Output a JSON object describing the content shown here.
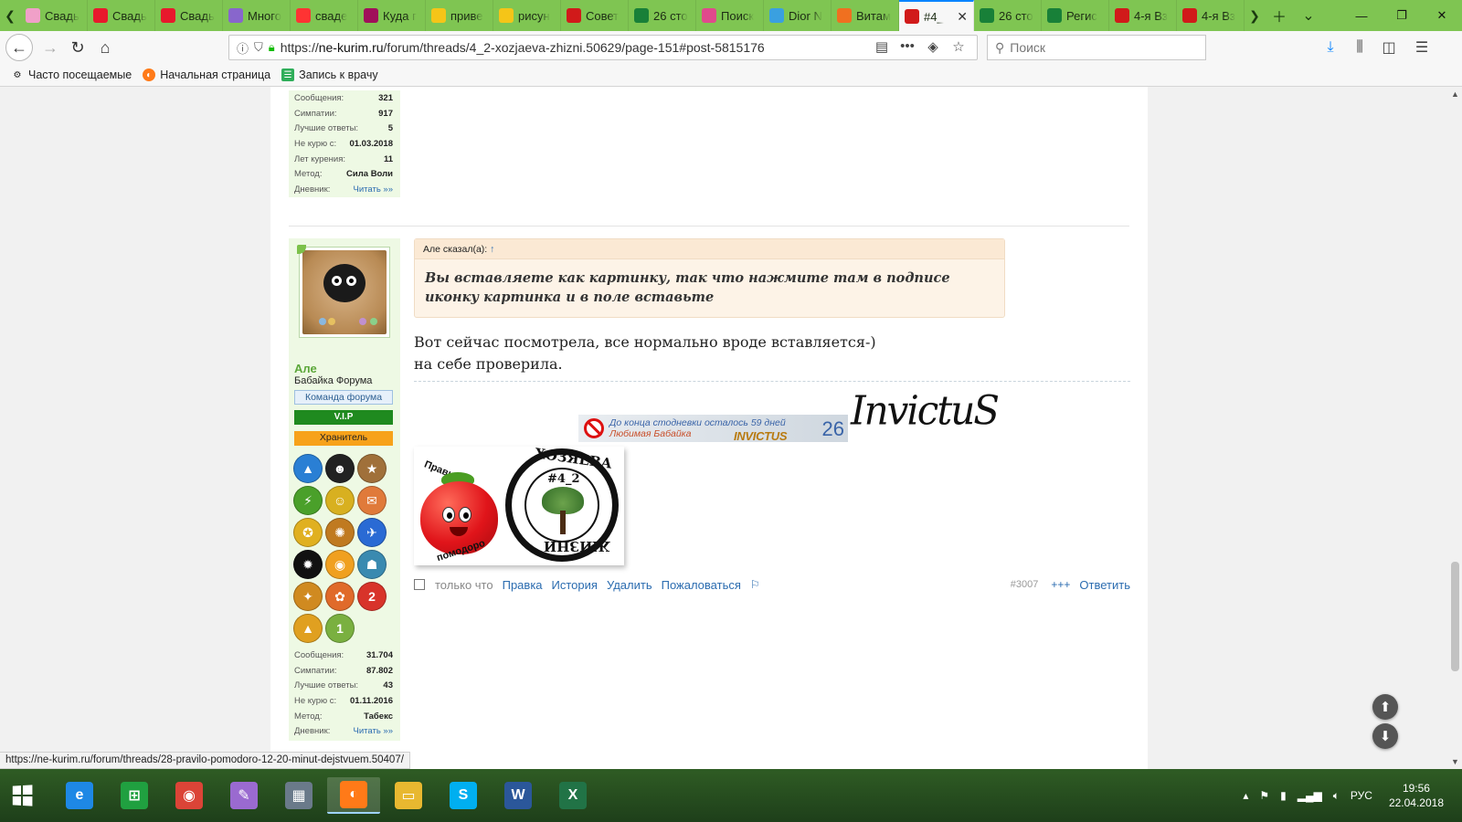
{
  "tabs": [
    {
      "label": "Свадь",
      "icon": "pink-ribbon-icon",
      "color": "#f0a0c8"
    },
    {
      "label": "Свадь",
      "icon": "heart-icon",
      "color": "#e8192c"
    },
    {
      "label": "Свадь",
      "icon": "heart-icon",
      "color": "#e8192c"
    },
    {
      "label": "Много",
      "icon": "stick-figure-icon",
      "color": "#8866cc"
    },
    {
      "label": "сваде",
      "icon": "yandex-icon",
      "color": "#ff3333"
    },
    {
      "label": "Куда г",
      "icon": "w-icon",
      "color": "#a0105a"
    },
    {
      "label": "приве",
      "icon": "sun-icon",
      "color": "#f5c518"
    },
    {
      "label": "рисун",
      "icon": "sun-icon",
      "color": "#f5c518"
    },
    {
      "label": "Совет",
      "icon": "no-entry-icon",
      "color": "#d11a1a"
    },
    {
      "label": "26 сто",
      "icon": "sheet-icon",
      "color": "#188038"
    },
    {
      "label": "Поиск",
      "icon": "butterfly-icon",
      "color": "#e04a8c"
    },
    {
      "label": "Dior N",
      "icon": "dots-icon",
      "color": "#3aa0e0"
    },
    {
      "label": "Витам",
      "icon": "carrot-icon",
      "color": "#f07020"
    },
    {
      "label": "#4_",
      "icon": "no-entry-icon",
      "color": "#d11a1a",
      "active": true
    },
    {
      "label": "26 сто",
      "icon": "sheet-icon",
      "color": "#188038"
    },
    {
      "label": "Регис",
      "icon": "sheet-icon",
      "color": "#188038"
    },
    {
      "label": "4-я Вз",
      "icon": "no-entry-icon",
      "color": "#d11a1a"
    },
    {
      "label": "4-я Вз",
      "icon": "no-entry-icon",
      "color": "#d11a1a"
    }
  ],
  "browser": {
    "url_prefix": "https://",
    "url_host": "ne-kurim.ru",
    "url_path": "/forum/threads/4_2-xozjaeva-zhizni.50629/page-151#post-5815176",
    "search_placeholder": "Поиск",
    "bookmarks": [
      "Часто посещаемые",
      "Начальная страница",
      "Запись к врачу"
    ]
  },
  "prev_user": {
    "stats": [
      {
        "label": "Сообщения:",
        "value": "321"
      },
      {
        "label": "Симпатии:",
        "value": "917"
      },
      {
        "label": "Лучшие ответы:",
        "value": "5"
      },
      {
        "label": "Не курю с:",
        "value": "01.03.2018"
      },
      {
        "label": "Лет курения:",
        "value": "11"
      },
      {
        "label": "Метод:",
        "value": "Сила Воли"
      },
      {
        "label": "Дневник:",
        "value": "Читать »»"
      }
    ]
  },
  "user": {
    "name": "Але",
    "title": "Бабайка Форума",
    "badge_team": "Команда форума",
    "badge_vip": "V.I.P",
    "badge_keeper": "Хранитель",
    "medals": [
      {
        "c": "#2a7fd4",
        "g": "▲"
      },
      {
        "c": "#222",
        "g": "☻"
      },
      {
        "c": "#a0703a",
        "g": "★"
      },
      {
        "c": "#4aa02a",
        "g": "⚡"
      },
      {
        "c": "#d8b020",
        "g": "☺"
      },
      {
        "c": "#e07a3a",
        "g": "✉"
      },
      {
        "c": "#e0b020",
        "g": "✪"
      },
      {
        "c": "#c07a20",
        "g": "✺"
      },
      {
        "c": "#2a6ad4",
        "g": "✈"
      },
      {
        "c": "#111",
        "g": "✹"
      },
      {
        "c": "#f0a020",
        "g": "◉"
      },
      {
        "c": "#3a8ab0",
        "g": "☗"
      },
      {
        "c": "#d08a20",
        "g": "✦"
      },
      {
        "c": "#e06a2a",
        "g": "✿"
      },
      {
        "c": "#d8332a",
        "g": "2"
      },
      {
        "c": "#e0a020",
        "g": "▲"
      },
      {
        "c": "#7ab040",
        "g": "1"
      }
    ],
    "stats": [
      {
        "label": "Сообщения:",
        "value": "31.704"
      },
      {
        "label": "Симпатии:",
        "value": "87.802"
      },
      {
        "label": "Лучшие ответы:",
        "value": "43"
      },
      {
        "label": "Не курю с:",
        "value": "01.11.2016"
      },
      {
        "label": "Метод:",
        "value": "Табекс"
      },
      {
        "label": "Дневник:",
        "value": "Читать »»"
      }
    ]
  },
  "post": {
    "quote_author": "Але сказал(а):",
    "quote_arrow": "↑",
    "quote_text": "Вы вставляете как картинку, так что нажмите там в подписе иконку картинка и в поле вставьте",
    "message_line1": "Вот сейчас посмотрела, все нормально вроде вставляется-)",
    "message_line2": "на себе проверила.",
    "signature": {
      "banner_line1": "До конца стодневки осталось 59 дней",
      "banner_line2": "Любимая Бабайка",
      "banner_brand": "INVICTUS",
      "banner_number": "26",
      "logo_text": "InvictuS",
      "tomato_top": "Правило",
      "tomato_bottom": "помодоро",
      "ring_top": "ХОЗЯЕВА",
      "ring_bottom": "ЖИЗНИ",
      "ring_number": "#4_2"
    },
    "actions": {
      "time": "только что",
      "edit": "Правка",
      "history": "История",
      "delete": "Удалить",
      "report": "Пожаловаться",
      "post_number": "#3007",
      "more": "+++",
      "reply": "Ответить"
    }
  },
  "status_url": "https://ne-kurim.ru/forum/threads/28-pravilo-pomodoro-12-20-minut-dejstvuem.50407/",
  "taskbar": {
    "apps": [
      {
        "name": "ie",
        "label": "e",
        "color": "#1e88e5"
      },
      {
        "name": "store",
        "label": "⊞",
        "color": "#20a040"
      },
      {
        "name": "chrome",
        "label": "◉",
        "color": "#db4437"
      },
      {
        "name": "paint",
        "label": "✎",
        "color": "#9a6ad0"
      },
      {
        "name": "calculator",
        "label": "▦",
        "color": "#6a7a8a"
      },
      {
        "name": "firefox",
        "label": "◐",
        "color": "#ff7a18",
        "active": true
      },
      {
        "name": "explorer",
        "label": "▭",
        "color": "#e8b830"
      },
      {
        "name": "skype",
        "label": "S",
        "color": "#00aff0"
      },
      {
        "name": "word",
        "label": "W",
        "color": "#2b579a"
      },
      {
        "name": "excel",
        "label": "X",
        "color": "#217346"
      }
    ],
    "lang": "РУС",
    "time": "19:56",
    "date": "22.04.2018"
  }
}
